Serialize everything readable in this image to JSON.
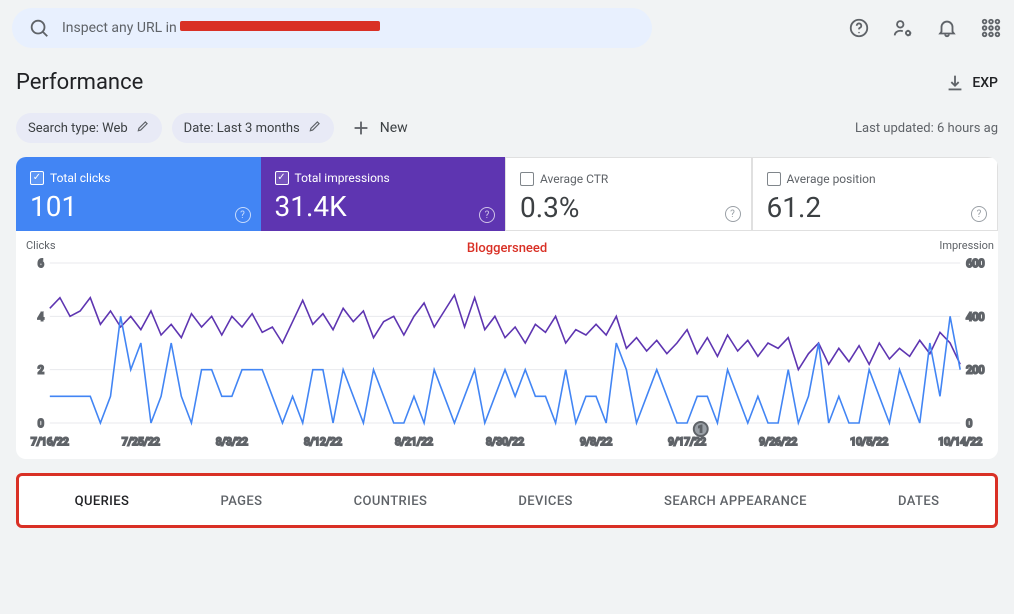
{
  "search": {
    "placeholder_prefix": "Inspect any URL in "
  },
  "header": {
    "title": "Performance",
    "export_label": "EXP"
  },
  "chips": {
    "search_type": "Search type: Web",
    "date_range": "Date: Last 3 months",
    "new_label": "New",
    "last_updated": "Last updated: 6 hours ag"
  },
  "metrics": {
    "total_clicks": {
      "label": "Total clicks",
      "value": "101",
      "active": true,
      "color": "blue"
    },
    "total_impressions": {
      "label": "Total impressions",
      "value": "31.4K",
      "active": true,
      "color": "purple"
    },
    "average_ctr": {
      "label": "Average CTR",
      "value": "0.3%",
      "active": false
    },
    "average_position": {
      "label": "Average position",
      "value": "61.2",
      "active": false
    }
  },
  "watermark": "Bloggersneed",
  "chart_data": {
    "type": "line",
    "x_label_left": "Clicks",
    "x_label_right": "Impression",
    "y_left": {
      "min": 0,
      "max": 6,
      "ticks": [
        0,
        2,
        4,
        6
      ]
    },
    "y_right": {
      "min": 0,
      "max": 600,
      "ticks": [
        0,
        200,
        400,
        600
      ]
    },
    "x_ticks": [
      "7/16/22",
      "7/25/22",
      "8/3/22",
      "8/12/22",
      "8/21/22",
      "8/30/22",
      "9/8/22",
      "9/17/22",
      "9/26/22",
      "10/5/22",
      "10/14/22"
    ],
    "annotations": [
      {
        "x_index_approx": 7.15,
        "label": "1"
      }
    ],
    "series": [
      {
        "name": "Clicks",
        "axis": "left",
        "color": "#4285f4",
        "values": [
          1,
          1,
          1,
          1,
          1,
          0,
          1,
          4,
          2,
          3,
          0,
          1,
          3,
          1,
          0,
          2,
          2,
          1,
          1,
          2,
          2,
          2,
          1,
          0,
          1,
          0,
          2,
          2,
          0,
          2,
          1,
          0,
          2,
          1,
          0,
          0,
          1,
          0,
          2,
          1,
          0,
          1,
          2,
          0,
          1,
          2,
          1,
          2,
          1,
          1,
          0,
          2,
          0,
          1,
          1,
          0,
          3,
          2,
          0,
          1,
          2,
          1,
          0,
          0,
          1,
          1,
          0,
          2,
          1,
          0,
          1,
          0,
          0,
          2,
          0,
          1,
          3,
          0,
          1,
          0,
          0,
          2,
          1,
          0,
          2,
          1,
          0,
          3,
          1,
          4,
          2
        ]
      },
      {
        "name": "Impressions",
        "axis": "right",
        "color": "#5e35b1",
        "values": [
          430,
          470,
          400,
          420,
          470,
          370,
          420,
          360,
          400,
          350,
          420,
          330,
          370,
          320,
          410,
          360,
          400,
          330,
          400,
          360,
          410,
          340,
          360,
          300,
          380,
          460,
          370,
          410,
          350,
          430,
          380,
          420,
          320,
          380,
          400,
          330,
          400,
          450,
          360,
          420,
          480,
          360,
          470,
          350,
          400,
          320,
          360,
          300,
          370,
          340,
          400,
          300,
          350,
          330,
          370,
          330,
          400,
          280,
          320,
          270,
          310,
          260,
          300,
          350,
          260,
          320,
          250,
          330,
          270,
          310,
          250,
          300,
          280,
          320,
          200,
          260,
          300,
          220,
          280,
          230,
          290,
          220,
          300,
          240,
          280,
          250,
          310,
          260,
          340,
          300,
          220
        ]
      }
    ]
  },
  "tabs": [
    "QUERIES",
    "PAGES",
    "COUNTRIES",
    "DEVICES",
    "SEARCH APPEARANCE",
    "DATES"
  ],
  "active_tab": "QUERIES"
}
